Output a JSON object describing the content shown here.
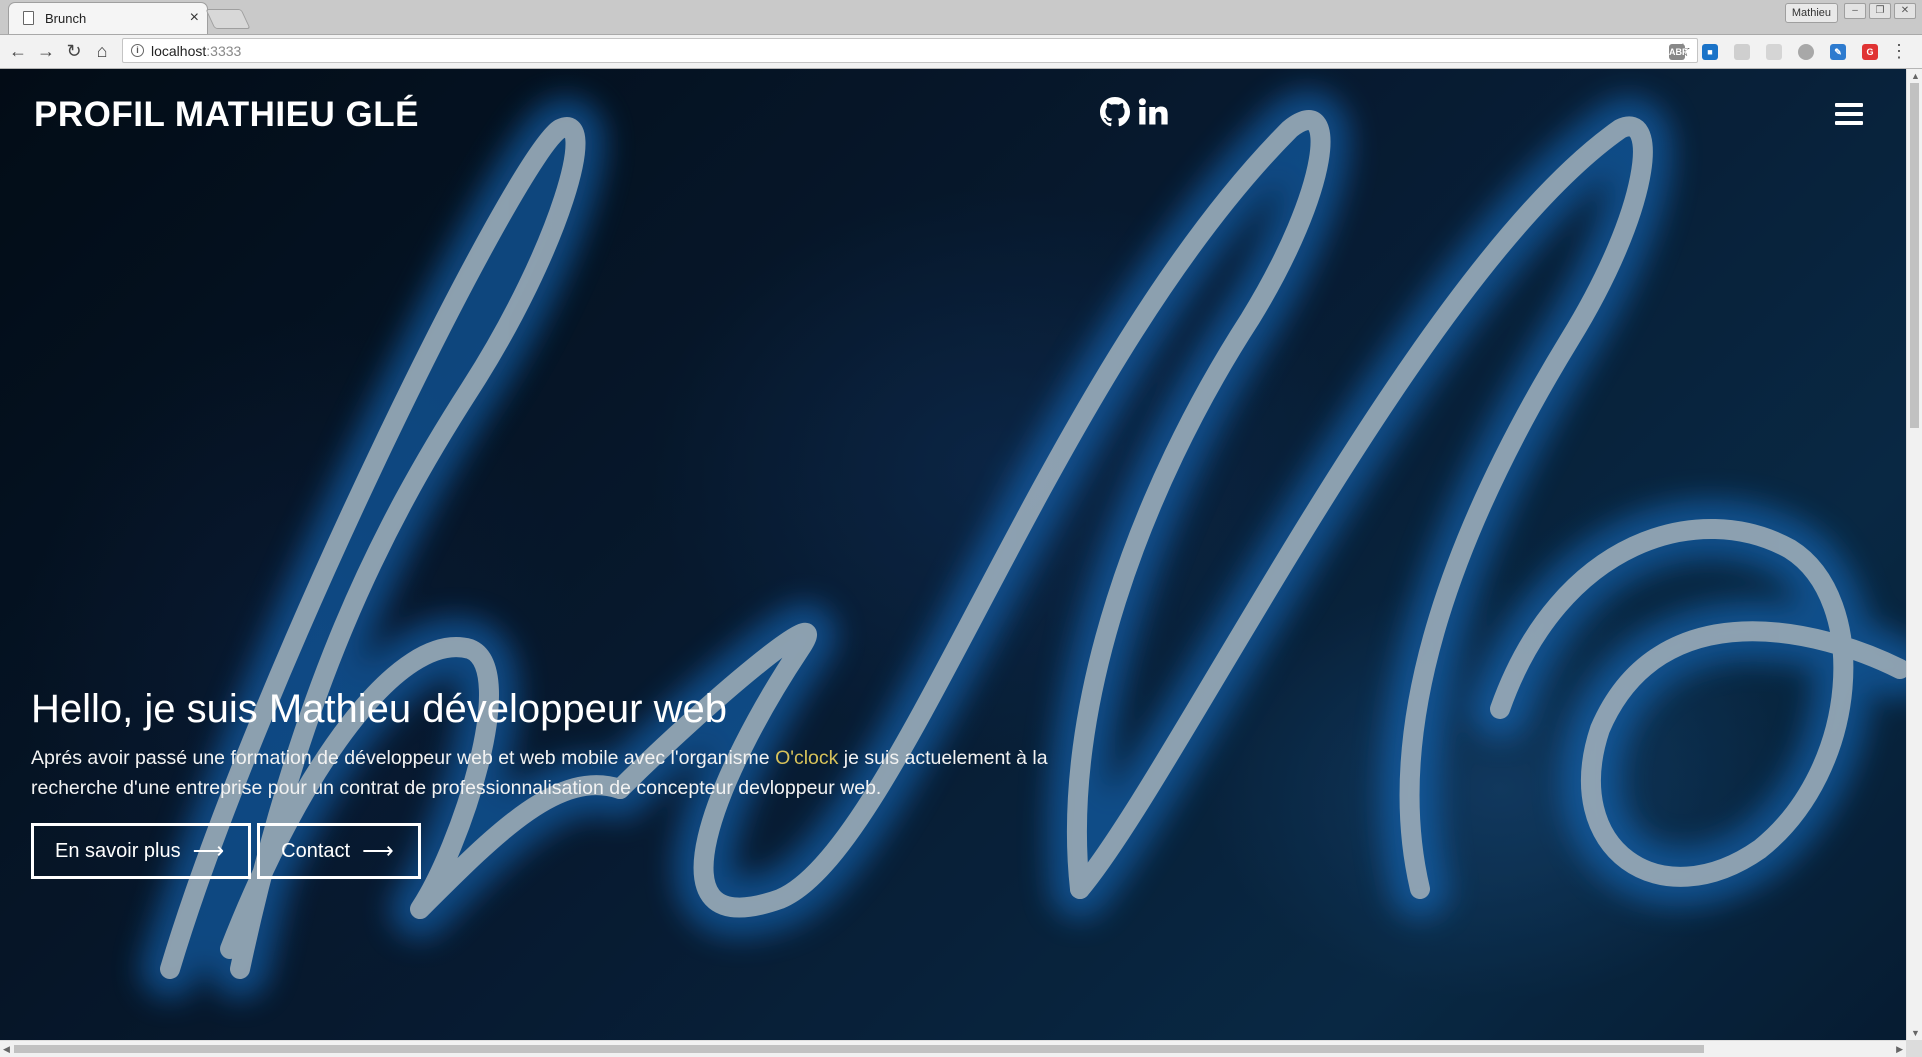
{
  "browser": {
    "tab_title": "Brunch",
    "tab_close": "×",
    "profile_name": "Mathieu",
    "url_host": "localhost",
    "url_port": ":3333"
  },
  "site": {
    "brand": "PROFIL MATHIEU GLÉ",
    "social_icons": [
      "github-icon",
      "linkedin-icon"
    ],
    "menu_icon": "hamburger-icon"
  },
  "hero": {
    "title": "Hello, je suis Mathieu développeur web",
    "text_before": "Aprés avoir passé une formation de développeur web et web mobile avec l'organisme ",
    "highlight": "O'clock",
    "text_after": " je suis actuelement à la recherche d'une entreprise pour un contrat de professionnalisation de concepteur devloppeur web.",
    "buttons": [
      {
        "label": "En savoir plus",
        "icon": "arrow-right-icon"
      },
      {
        "label": "Contact",
        "icon": "arrow-right-icon"
      }
    ]
  },
  "colors": {
    "highlight": "#d7c25a",
    "background_dark": "#04101d",
    "neon_blue": "#1e90ff"
  }
}
